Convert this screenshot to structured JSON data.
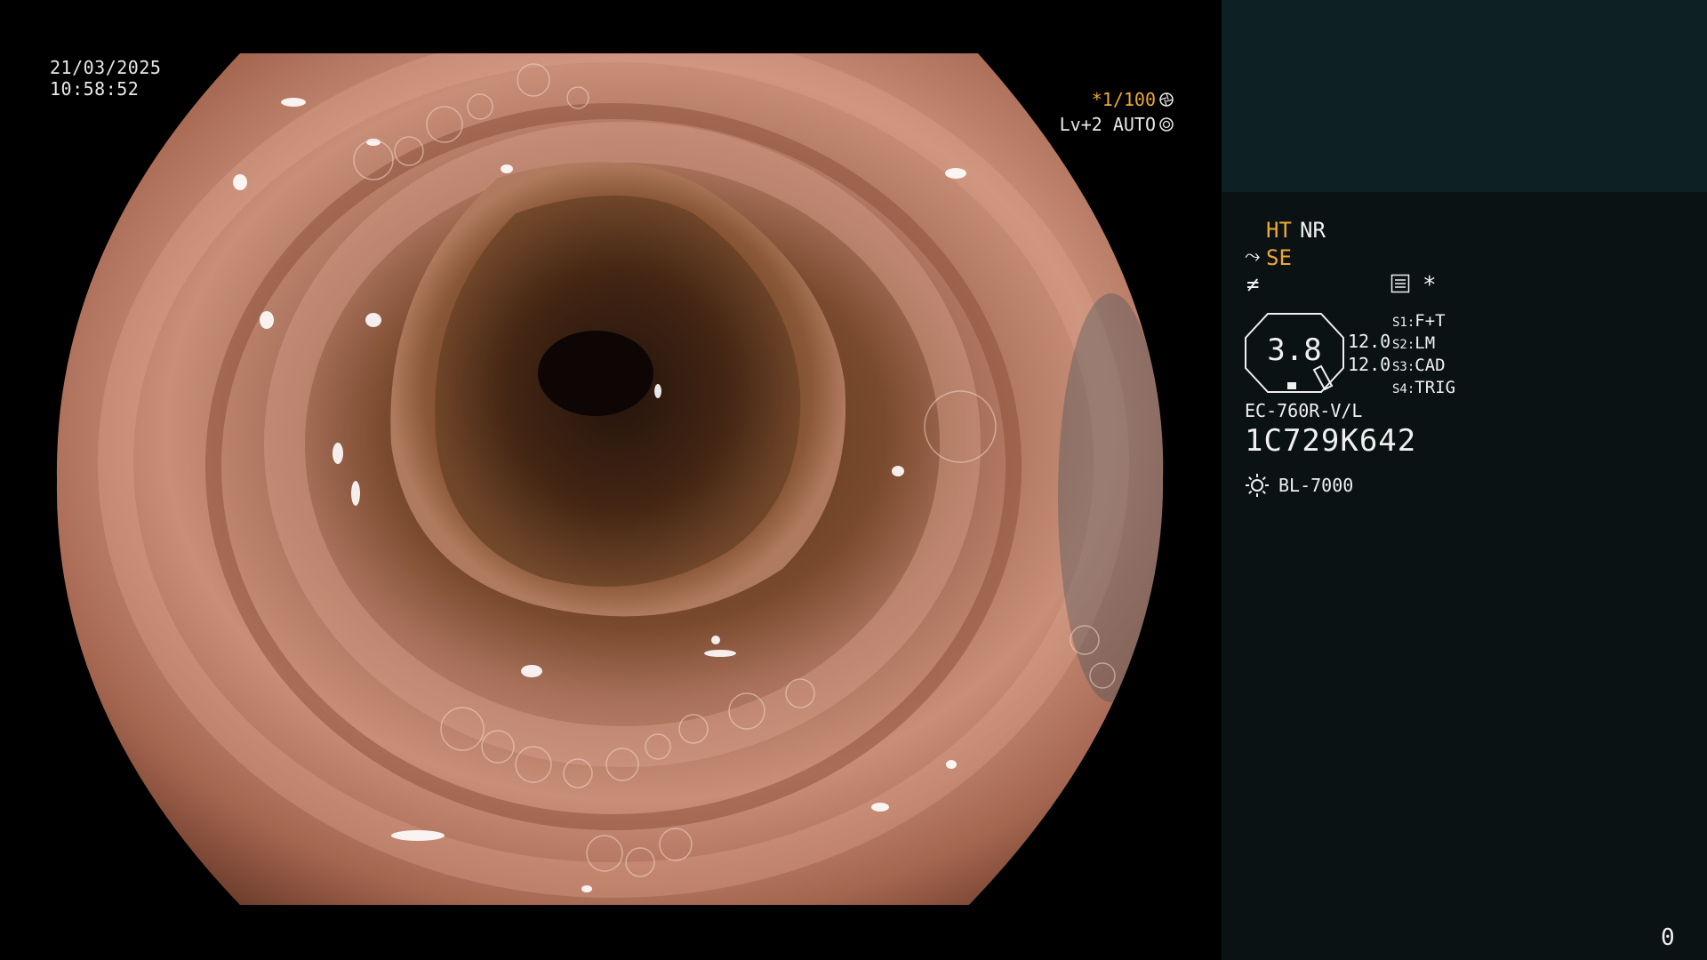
{
  "overlay": {
    "date": "21/03/2025",
    "time": "10:58:52",
    "shutter": "*1/100",
    "level": "Lv+2 AUTO"
  },
  "panel": {
    "ht": "HT",
    "nr": "NR",
    "se": "SE",
    "star": "*",
    "octagon_value": "3.8",
    "value_1": "12.0",
    "value_2": "12.0",
    "switches": [
      {
        "key": "S1:",
        "value": "F+T"
      },
      {
        "key": "S2:",
        "value": "LM"
      },
      {
        "key": "S3:",
        "value": "CAD"
      },
      {
        "key": "S4:",
        "value": "TRIG"
      }
    ],
    "scope_model": "EC-760R-V/L",
    "scope_serial": "1C729K642",
    "light_source": "BL-7000",
    "counter": "0"
  },
  "colors": {
    "accent_orange": "#f0a830",
    "text_white": "#f0f0f0",
    "panel_bg": "#0a1214",
    "thumb_bg": "#0d2024"
  },
  "icons": [
    "aperture-icon",
    "iris-icon",
    "se-icon",
    "f-icon",
    "menu-icon",
    "sun-icon"
  ]
}
